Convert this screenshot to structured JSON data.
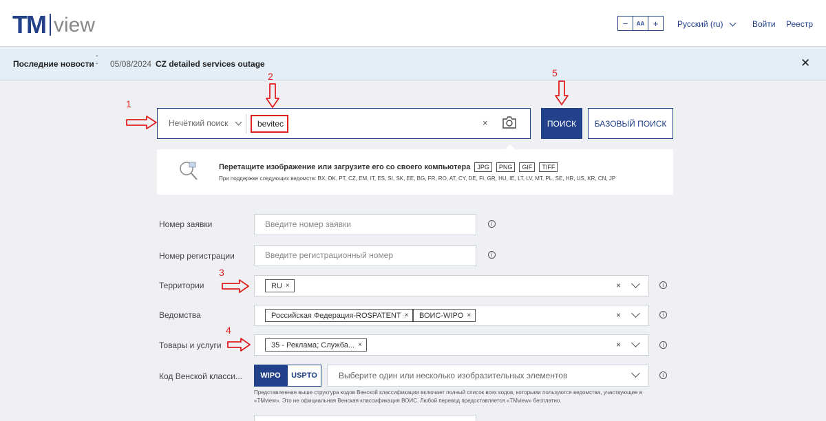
{
  "header": {
    "logo_tm": "TM",
    "logo_view": "view",
    "font_decrease": "−",
    "font_reset": "AA",
    "font_increase": "+",
    "language": "Русский (ru)",
    "login": "Войти",
    "register": "Реестр"
  },
  "news": {
    "label": "Последние новости",
    "date": "05/08/2024",
    "title": "CZ detailed services outage",
    "close": "✕"
  },
  "search": {
    "mode": "Нечёткий поиск",
    "query": "bevitec",
    "clear": "×",
    "search_button": "ПОИСК",
    "basic_button": "БАЗОВЫЙ ПОИСК"
  },
  "image_search": {
    "drag_text": "Перетащите изображение или загрузите его со своего компьютера",
    "formats": [
      "JPG",
      "PNG",
      "GIF",
      "TIFF"
    ],
    "offices_text": "При поддержке следующих ведомств: BX, DK, PT, CZ, EM, IT, ES, SI, SK, EE, BG, FR, RO, AT, CY, DE, FI, GR, HU, IE, LT, LV, MT, PL, SE, HR, US, KR, CN, JP"
  },
  "form": {
    "application_number": {
      "label": "Номер заявки",
      "placeholder": "Введите номер заявки"
    },
    "registration_number": {
      "label": "Номер регистрации",
      "placeholder": "Введите регистрационный номер"
    },
    "territories": {
      "label": "Территории",
      "chips": [
        "RU"
      ]
    },
    "offices": {
      "label": "Ведомства",
      "chips": [
        "Российская Федерация-ROSPATENT",
        "ВОИС-WIPO"
      ]
    },
    "goods_services": {
      "label": "Товары и услуги",
      "chips": [
        "35 - Реклама; Служба..."
      ]
    },
    "vienna": {
      "label": "Код Венской класси...",
      "wipo": "WIPO",
      "uspto": "USPTO",
      "placeholder": "Выберите один или несколько изобразительных элементов",
      "note": "Представленная выше структура кодов Венской классификации включает полный список всех кодов, которыми пользуются ведомства, участвующие в «TMview». Это не официальная Венская классификация ВОИС. Любой перевод предоставляется «TMview» бесплатно."
    },
    "chip_remove": "×",
    "field_clear": "×",
    "info_symbol": "i"
  },
  "annotations": [
    "1",
    "2",
    "3",
    "4",
    "5"
  ],
  "colors": {
    "brand": "#22418a",
    "annotation": "#e01e1e",
    "news_bg": "#e3eef6",
    "page_bg": "#eef0f4"
  },
  "icons": [
    "camera-icon",
    "magnifier-image-icon",
    "info-icon",
    "chevron-down-icon",
    "close-icon"
  ]
}
